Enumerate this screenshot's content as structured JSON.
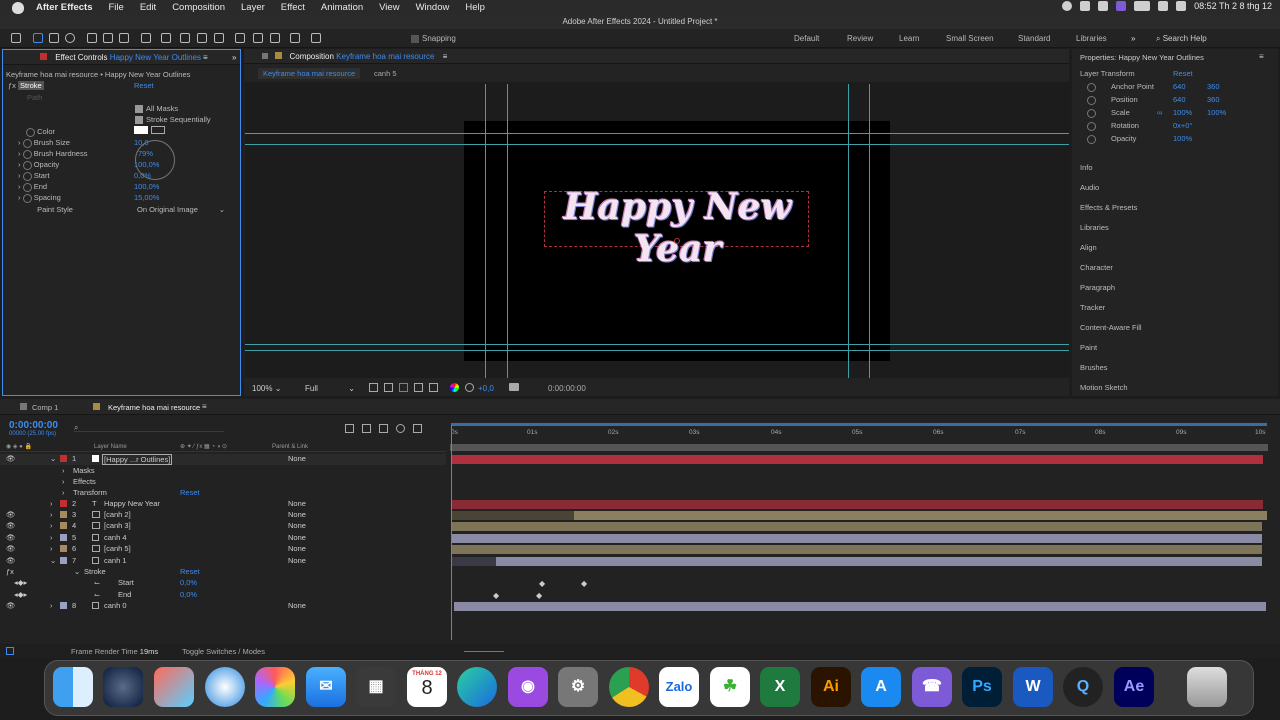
{
  "menubar": {
    "app": "After Effects",
    "items": [
      "File",
      "Edit",
      "Composition",
      "Layer",
      "Effect",
      "Animation",
      "View",
      "Window",
      "Help"
    ],
    "clock": "08:52 Th 2 8 thg 12"
  },
  "window": {
    "title": "Adobe After Effects 2024 - Untitled Project *"
  },
  "toolbar": {
    "snapping": "Snapping",
    "workspaces": [
      "Default",
      "Review",
      "Learn",
      "Small Screen",
      "Standard",
      "Libraries"
    ],
    "search": "Search Help"
  },
  "effect_controls": {
    "tab_label": "Effect Controls",
    "tab_target": "Happy New Year Outlines",
    "crumb": "Keyframe hoa mai resource • Happy New Year Outlines",
    "effect": "Stroke",
    "reset": "Reset",
    "path": "Path",
    "all_masks": "All Masks",
    "stroke_seq": "Stroke Sequentially",
    "props": [
      {
        "name": "Color",
        "value": ""
      },
      {
        "name": "Brush Size",
        "value": "10,0"
      },
      {
        "name": "Brush Hardness",
        "value": "79%"
      },
      {
        "name": "Opacity",
        "value": "100,0%"
      },
      {
        "name": "Start",
        "value": "0,0%"
      },
      {
        "name": "End",
        "value": "100,0%"
      },
      {
        "name": "Spacing",
        "value": "15,00%"
      }
    ],
    "paint_style_label": "Paint Style",
    "paint_style": "On Original Image"
  },
  "composition": {
    "tab_label": "Composition",
    "tab_target": "Keyframe hoa mai resource",
    "subtabs": [
      "Keyframe hoa mai resource",
      "canh 5"
    ],
    "title_text": "Happy New Year",
    "zoom": "100%",
    "resolution": "Full",
    "exposure": "+0,0",
    "timecode": "0:00:00:00"
  },
  "properties": {
    "title": "Properties: Happy New Year Outlines",
    "section": "Layer Transform",
    "reset": "Reset",
    "rows": [
      {
        "name": "Anchor Point",
        "v1": "640",
        "v2": "360"
      },
      {
        "name": "Position",
        "v1": "640",
        "v2": "360"
      },
      {
        "name": "Scale",
        "v1": "100%",
        "v2": "100%"
      },
      {
        "name": "Rotation",
        "v1": "0x+0°",
        "v2": ""
      },
      {
        "name": "Opacity",
        "v1": "100%",
        "v2": ""
      }
    ],
    "panels": [
      "Info",
      "Audio",
      "Effects & Presets",
      "Libraries",
      "Align",
      "Character",
      "Paragraph",
      "Tracker",
      "Content-Aware Fill",
      "Paint",
      "Brushes",
      "Motion Sketch"
    ]
  },
  "timeline": {
    "tabs": [
      "Comp 1",
      "Keyframe hoa mai resource"
    ],
    "timecode": "0:00:00:00",
    "fps": "00000 (25.00 fps)",
    "col_layer": "Layer Name",
    "col_parent": "Parent & Link",
    "ruler": [
      "0s",
      "01s",
      "02s",
      "03s",
      "04s",
      "05s",
      "06s",
      "07s",
      "08s",
      "09s",
      "10s"
    ],
    "layers": [
      {
        "num": "1",
        "name": "[Happy ...r Outlines]",
        "parent": "None"
      },
      {
        "num": "",
        "name": "Masks",
        "parent": ""
      },
      {
        "num": "",
        "name": "Effects",
        "parent": ""
      },
      {
        "num": "",
        "name": "Transform",
        "parent": "Reset"
      },
      {
        "num": "2",
        "name": "Happy New Year",
        "parent": "None"
      },
      {
        "num": "3",
        "name": "[canh 2]",
        "parent": "None"
      },
      {
        "num": "4",
        "name": "[canh 3]",
        "parent": "None"
      },
      {
        "num": "5",
        "name": "canh 4",
        "parent": "None"
      },
      {
        "num": "6",
        "name": "[canh 5]",
        "parent": "None"
      },
      {
        "num": "7",
        "name": "canh 1",
        "parent": "None"
      },
      {
        "num": "",
        "name": "Stroke",
        "parent": "Reset"
      },
      {
        "num": "",
        "name": "Start",
        "parent": "0,0%"
      },
      {
        "num": "",
        "name": "End",
        "parent": "0,0%"
      },
      {
        "num": "8",
        "name": "canh 0",
        "parent": "None"
      }
    ],
    "render_time_label": "Frame Render Time",
    "render_time": "19ms",
    "toggle": "Toggle Switches / Modes"
  },
  "dock": {
    "calendar_month": "THÁNG 12",
    "calendar_day": "8",
    "apps": [
      "Finder",
      "Cinema 4D",
      "Launchpad",
      "Safari",
      "Photos",
      "Mail",
      "Calculator",
      "Calendar",
      "Edge",
      "Podcasts",
      "System Settings",
      "Chrome",
      "Zalo",
      "Nimble",
      "Excel",
      "Illustrator",
      "App Store",
      "Viber",
      "Photoshop",
      "Word",
      "QuickTime",
      "After Effects",
      "Trash"
    ]
  }
}
